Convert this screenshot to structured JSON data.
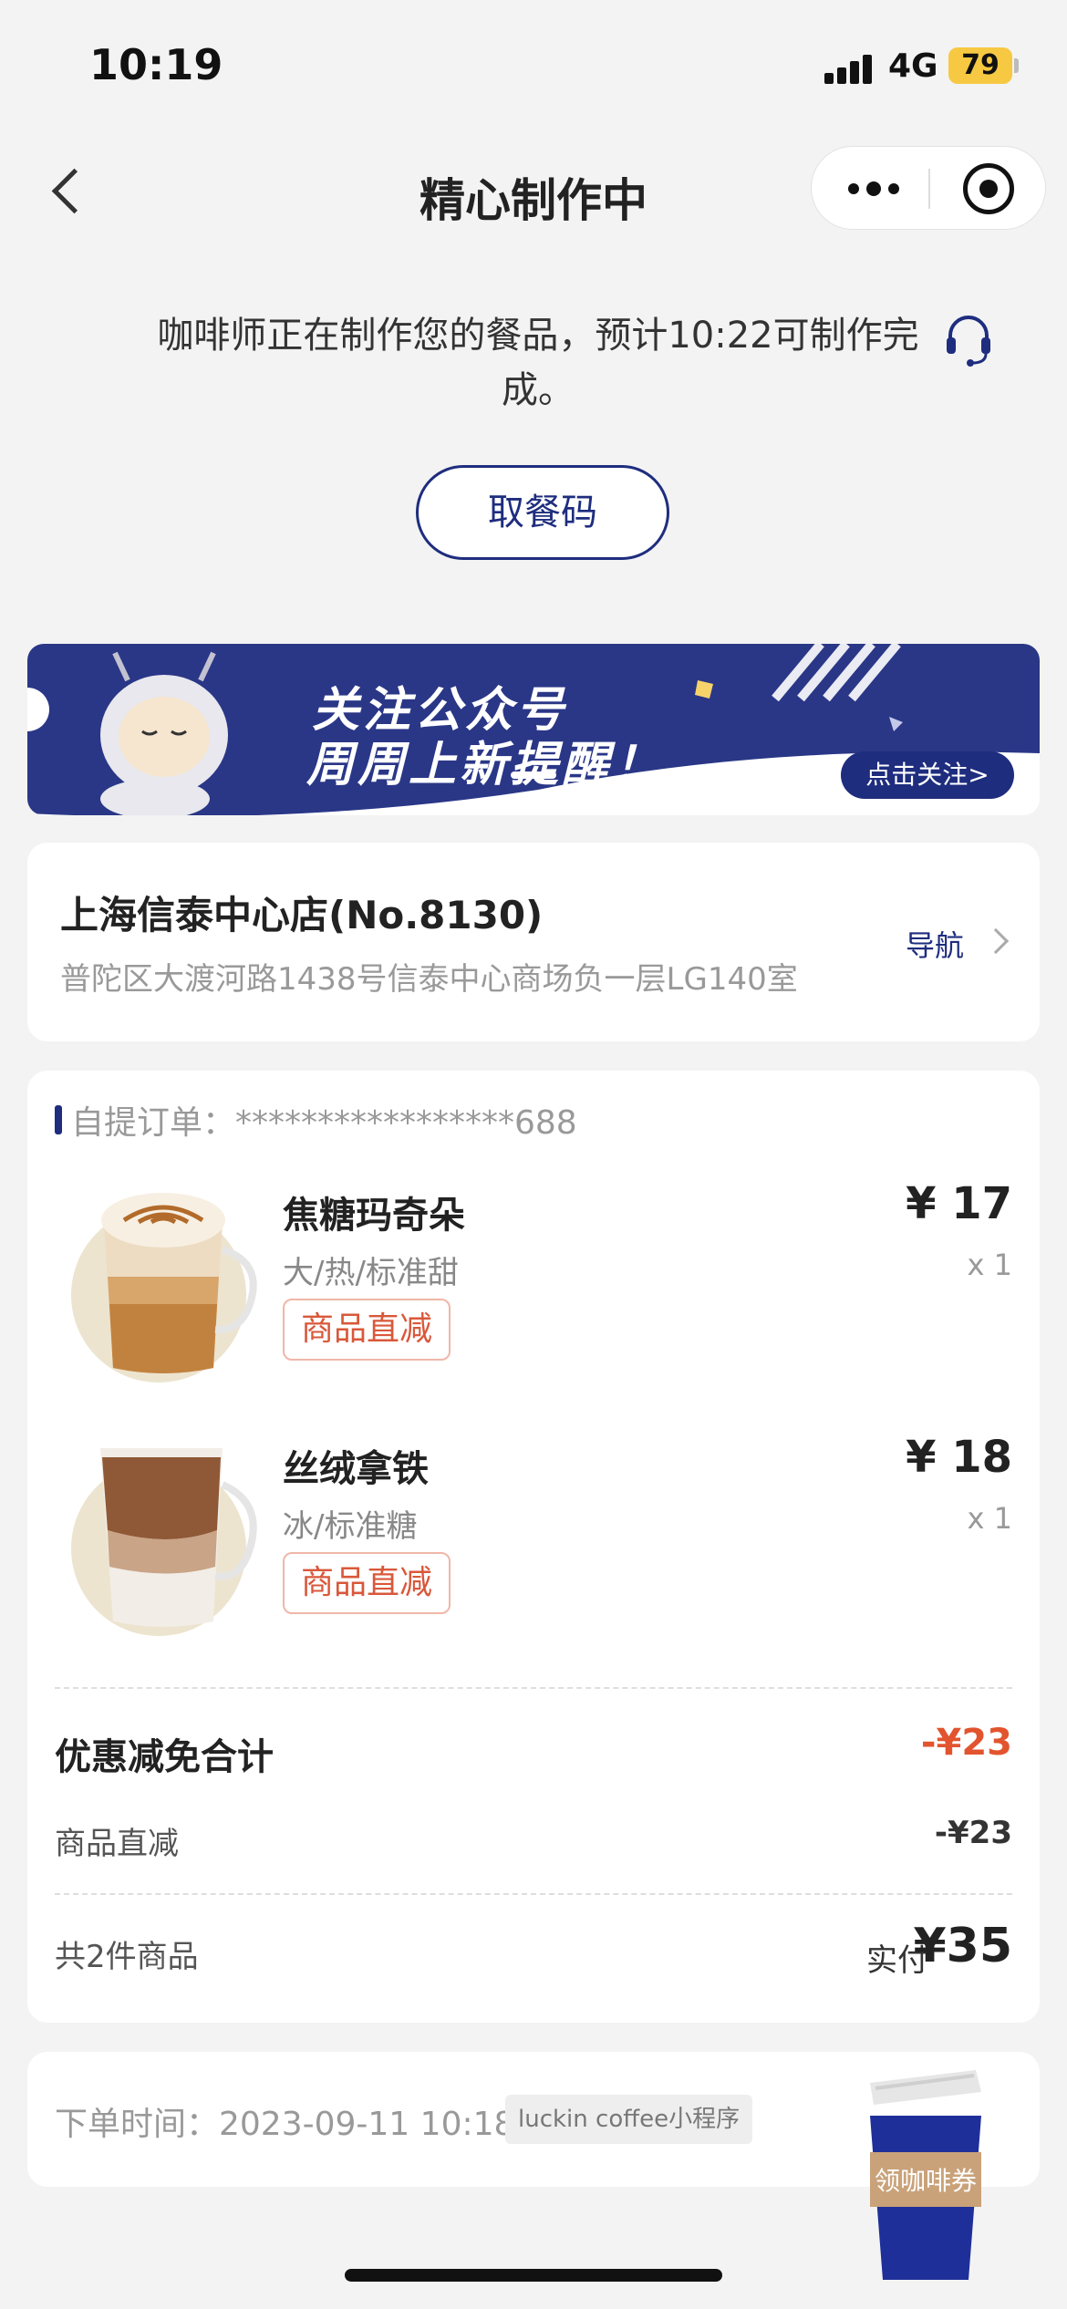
{
  "status_bar": {
    "time": "10:19",
    "network": "4G",
    "battery": "79"
  },
  "nav": {
    "title": "精心制作中"
  },
  "status_message": "咖啡师正在制作您的餐品，预计10:22可制作完成。",
  "pickup_button": "取餐码",
  "banner": {
    "line1": "关注公众号",
    "line2": "周周上新提醒！",
    "button": "点击关注>"
  },
  "store": {
    "name": "上海信泰中心店(No.8130)",
    "address": "普陀区大渡河路1438号信泰中心商场负一层LG140室",
    "nav_label": "导航"
  },
  "order": {
    "label": "自提订单：*****************688",
    "items": [
      {
        "name": "焦糖玛奇朵",
        "spec": "大/热/标准甜",
        "tag": "商品直减",
        "price": "¥ 17",
        "qty": "x 1"
      },
      {
        "name": "丝绒拿铁",
        "spec": "冰/标准糖",
        "tag": "商品直减",
        "price": "¥ 18",
        "qty": "x 1"
      }
    ],
    "discount_title": "优惠减免合计",
    "discount_total": "-¥23",
    "discount_row_label": "商品直减",
    "discount_row_value": "-¥23",
    "count": "共2件商品",
    "paid_label": "实付",
    "paid_value": "¥35"
  },
  "order_time": {
    "text": "下单时间：2023-09-11 10:18",
    "source_tag": "luckin coffee小程序"
  },
  "coupon_cup_label": "领咖啡券",
  "colors": {
    "brand": "#1e2d7e",
    "discount": "#e2542e",
    "tag": "#d9583a"
  }
}
